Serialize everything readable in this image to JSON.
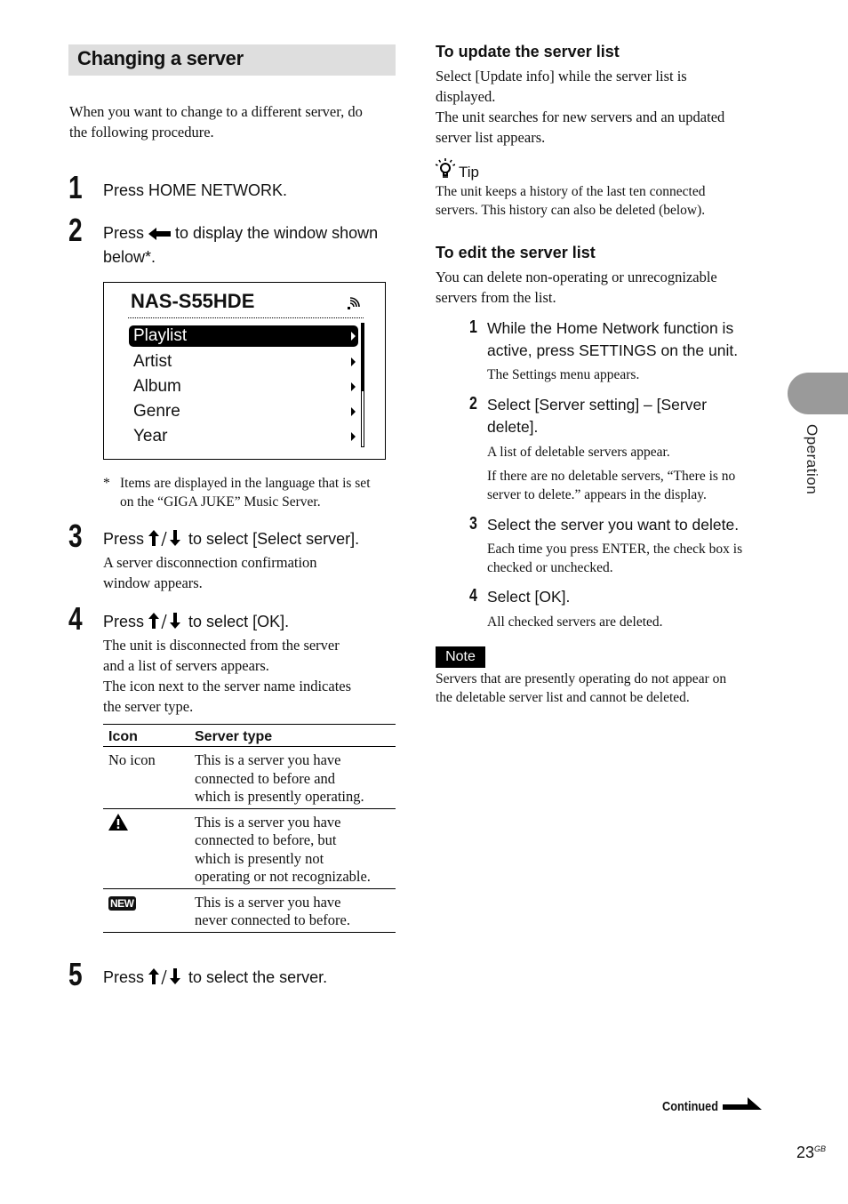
{
  "section_title": "Changing a server",
  "intro": [
    "When you want to change to a different server, do",
    "the following procedure."
  ],
  "steps": [
    {
      "num": "1",
      "text": "Press HOME NETWORK."
    },
    {
      "num": "2",
      "text_before": "Press",
      "text_after": "to display the window shown",
      "text_line2": "below*.",
      "icon": "back-arrow-icon"
    },
    {
      "num": "3",
      "text_before": "Press",
      "text_after": "to select [Select server].",
      "detail": [
        "A server disconnection confirmation",
        "window appears."
      ]
    },
    {
      "num": "4",
      "text_before": "Press",
      "text_after": "to select [OK].",
      "detail": [
        "The unit is disconnected from the server",
        "and a list of servers appears.",
        "The icon next to the server name indicates",
        "the server type."
      ]
    },
    {
      "num": "5",
      "text_before": "Press",
      "text_after": "to select the server."
    }
  ],
  "screen": {
    "title": "NAS-S55HDE",
    "items": [
      "Playlist",
      "Artist",
      "Album",
      "Genre",
      "Year"
    ],
    "selected_index": 0,
    "scroll_fraction": 0.55
  },
  "footnote": {
    "mark": "*",
    "lines": [
      "Items are displayed in the language that is set",
      "on the “GIGA JUKE” Music Server."
    ]
  },
  "table": {
    "headers": [
      "Icon",
      "Server type"
    ],
    "rows": [
      {
        "icon": "No icon",
        "desc": [
          "This is a server you have",
          "connected to before and",
          "which is presently operating."
        ]
      },
      {
        "icon": "warning-icon",
        "desc": [
          "This is a server you have",
          "connected to before, but",
          "which is presently not",
          "operating or not recognizable."
        ]
      },
      {
        "icon": "new-icon",
        "icon_text": "NEW",
        "desc": [
          "This is a server you have",
          "never connected to before."
        ]
      }
    ]
  },
  "update": {
    "heading": "To update the server list",
    "lines": [
      "Select [Update info] while the server list is",
      "displayed.",
      "The unit searches for new servers and an updated",
      "server list appears."
    ]
  },
  "tip": {
    "label": "Tip",
    "lines": [
      "The unit keeps a history of the last ten connected",
      "servers. This history can also be deleted (below)."
    ]
  },
  "edit": {
    "heading": "To edit the server list",
    "lines": [
      "You can delete non-operating or unrecognizable",
      "servers from the list."
    ],
    "steps": [
      {
        "num": "1",
        "text": [
          "While the Home Network function is",
          "active, press SETTINGS on the unit."
        ],
        "detail": [
          "The Settings menu appears."
        ]
      },
      {
        "num": "2",
        "text": [
          "Select [Server setting] – [Server",
          "delete]."
        ],
        "detail": [
          "A list of deletable servers appear."
        ],
        "detail2": [
          "If there are no deletable servers, “There is no",
          "server to delete.” appears in the display."
        ]
      },
      {
        "num": "3",
        "text": [
          "Select the server you want to delete."
        ],
        "detail": [
          "Each time you press ENTER, the check box is",
          "checked or unchecked."
        ]
      },
      {
        "num": "4",
        "text": [
          "Select [OK]."
        ],
        "detail": [
          "All checked servers are deleted."
        ]
      }
    ]
  },
  "note": {
    "label": "Note",
    "lines": [
      "Servers that are presently operating do not appear on",
      "the deletable server list and cannot be deleted."
    ]
  },
  "side_tab": "Operation",
  "continued": "Continued",
  "page_number": "23",
  "page_suffix": "GB"
}
